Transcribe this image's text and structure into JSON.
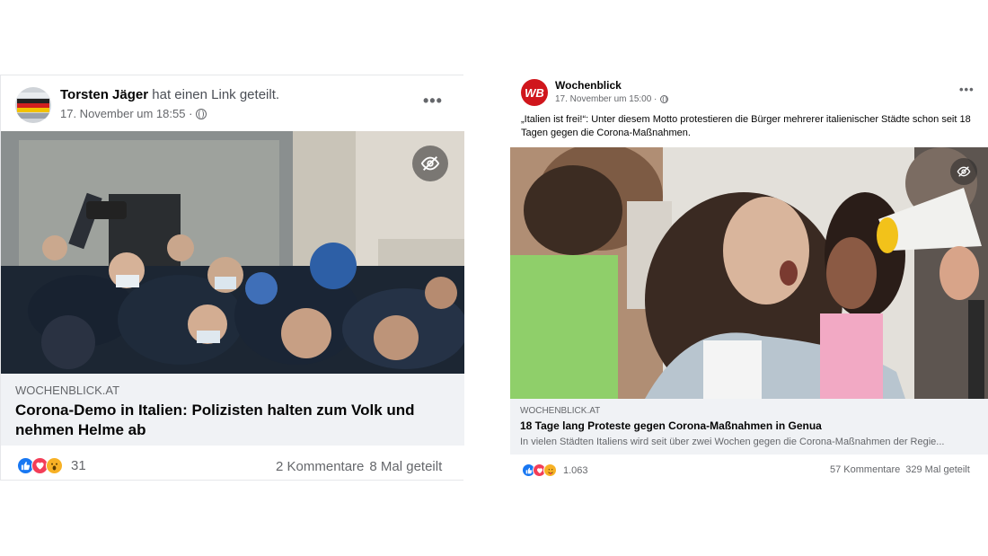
{
  "post1": {
    "author": "Torsten Jäger",
    "action": "hat einen Link geteilt.",
    "time": "17. November um 18:55 ·",
    "link": {
      "domain": "WOCHENBLICK.AT",
      "title": "Corona-Demo in Italien: Polizisten halten zum Volk und nehmen Helme ab"
    },
    "reactions_count": "31",
    "comments": "2 Kommentare",
    "shares": "8 Mal geteilt"
  },
  "post2": {
    "author": "Wochenblick",
    "avatar_text": "WB",
    "time": "17. November um 15:00 ·",
    "text": "„Italien ist frei!“: Unter diesem Motto protestieren die Bürger mehrerer italienischer Städte schon seit 18 Tagen gegen die Corona-Maßnahmen.",
    "link": {
      "domain": "WOCHENBLICK.AT",
      "title": "18 Tage lang Proteste gegen Corona-Maßnahmen in Genua",
      "description": "In vielen Städten Italiens wird seit über zwei Wochen gegen die Corona-Maßnahmen der Regie..."
    },
    "reactions_count": "1.063",
    "comments": "57 Kommentare",
    "shares": "329 Mal geteilt"
  },
  "icons": {
    "more": "more-icon",
    "globe": "globe-icon",
    "hidden": "eye-off-icon",
    "like": "like-reaction-icon",
    "love": "love-reaction-icon",
    "wow": "wow-reaction-icon",
    "care": "care-reaction-icon"
  },
  "colors": {
    "like": "#1877f2",
    "love": "#f33e58",
    "wow": "#f7b125",
    "link_bg": "#f0f2f5",
    "secondary_text": "#65676b",
    "wochenblick_red": "#d0161c"
  }
}
